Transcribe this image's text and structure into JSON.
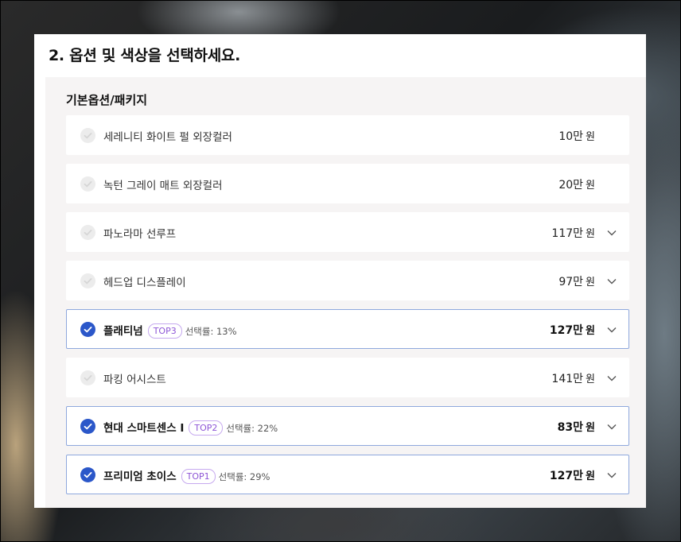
{
  "panel": {
    "title": "2. 옵션 및 색상을 선택하세요."
  },
  "section": {
    "title": "기본옵션/패키지"
  },
  "options": [
    {
      "name": "세레니티 화이트 펄 외장컬러",
      "price": "10만",
      "unit": "원",
      "selected": false,
      "expandable": false
    },
    {
      "name": "녹턴 그레이 매트 외장컬러",
      "price": "20만",
      "unit": "원",
      "selected": false,
      "expandable": false
    },
    {
      "name": "파노라마 선루프",
      "price": "117만",
      "unit": "원",
      "selected": false,
      "expandable": true
    },
    {
      "name": "헤드업 디스플레이",
      "price": "97만",
      "unit": "원",
      "selected": false,
      "expandable": true
    },
    {
      "name": "플래티넘",
      "badge": "TOP3",
      "rate": "선택률: 13%",
      "price": "127만",
      "unit": "원",
      "selected": true,
      "expandable": true
    },
    {
      "name": "파킹 어시스트",
      "price": "141만",
      "unit": "원",
      "selected": false,
      "expandable": true
    },
    {
      "name": "현대 스마트센스 Ⅰ",
      "badge": "TOP2",
      "rate": "선택률: 22%",
      "price": "83만",
      "unit": "원",
      "selected": true,
      "expandable": true
    },
    {
      "name": "프리미엄 초이스",
      "badge": "TOP1",
      "rate": "선택률: 29%",
      "price": "127만",
      "unit": "원",
      "selected": true,
      "expandable": true
    }
  ],
  "icons": {
    "check": "check-circle-icon",
    "expand": "chevron-down-icon"
  },
  "colors": {
    "accent": "#2b57c9",
    "badge": "#8d55d6",
    "selected_border": "#8ea8dd"
  }
}
